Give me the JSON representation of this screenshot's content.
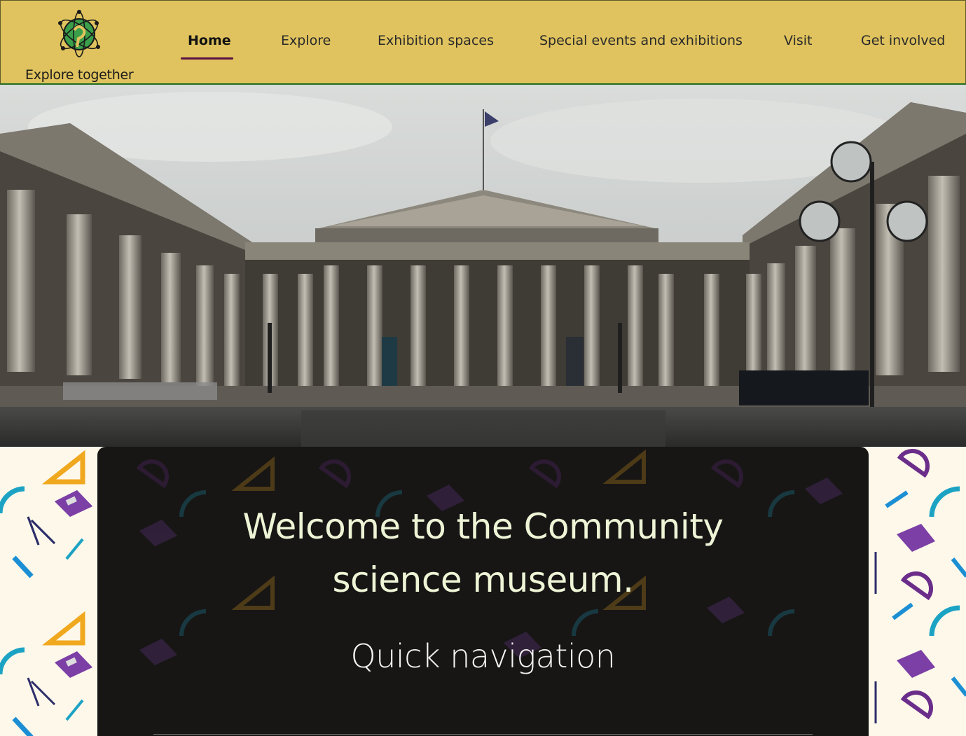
{
  "header": {
    "logo_text": "Explore together",
    "nav": [
      {
        "label": "Home",
        "active": true
      },
      {
        "label": "Explore",
        "active": false
      },
      {
        "label": "Exhibition spaces",
        "active": false
      },
      {
        "label": "Special events and exhibitions",
        "active": false
      },
      {
        "label": "Visit",
        "active": false
      },
      {
        "label": "Get involved",
        "active": false
      }
    ]
  },
  "hero": {
    "image": "museum-building-photo"
  },
  "main": {
    "welcome_title": "Welcome to the Community science museum.",
    "welcome_line1": "Welcome to the Community",
    "welcome_line2": "science museum.",
    "quick_nav_heading": "Quick navigation"
  },
  "colors": {
    "header_bg": "#e0c35e",
    "active_underline": "#5a1040",
    "panel_bg": "#171615",
    "title_text": "#eef5d6",
    "pattern_bg": "#fdf8ea"
  }
}
